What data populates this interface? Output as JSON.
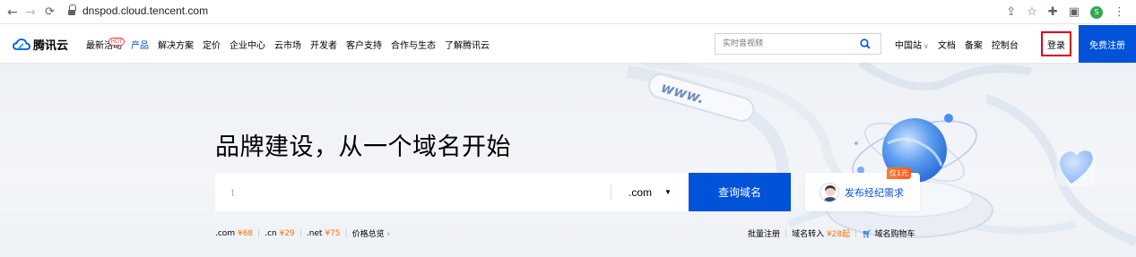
{
  "browser": {
    "url": "dnspod.cloud.tencent.com",
    "profile_initial": "S"
  },
  "header": {
    "logo_text": "腾讯云",
    "nav": [
      {
        "label": "最新活动",
        "badge": "HOT"
      },
      {
        "label": "产品",
        "active": true
      },
      {
        "label": "解决方案"
      },
      {
        "label": "定价"
      },
      {
        "label": "企业中心"
      },
      {
        "label": "云市场"
      },
      {
        "label": "开发者"
      },
      {
        "label": "客户支持"
      },
      {
        "label": "合作与生态"
      },
      {
        "label": "了解腾讯云"
      }
    ],
    "search_placeholder": "实时音视频",
    "region": "中国站",
    "docs": "文档",
    "filing": "备案",
    "console": "控制台",
    "login": "登录",
    "register": "免费注册"
  },
  "hero": {
    "headline": "品牌建设，从一个域名开始",
    "domain_input_value": "t",
    "tld": ".com",
    "search_button": "查询域名",
    "broker_badge": "仅1元",
    "broker_label": "发布经纪需求",
    "decor_text": "www.",
    "prices": [
      {
        "tld": ".com",
        "price": "¥68"
      },
      {
        "tld": ".cn",
        "price": "¥29"
      },
      {
        "tld": ".net",
        "price": "¥75"
      }
    ],
    "price_overview": "价格总览",
    "bulk_register": "批量注册",
    "transfer_label": "域名转入",
    "transfer_price": "¥28起",
    "cart": "域名购物车"
  },
  "colors": {
    "brand_blue": "#0052d9",
    "price_orange": "#ff7200",
    "login_highlight": "#d9001b"
  }
}
